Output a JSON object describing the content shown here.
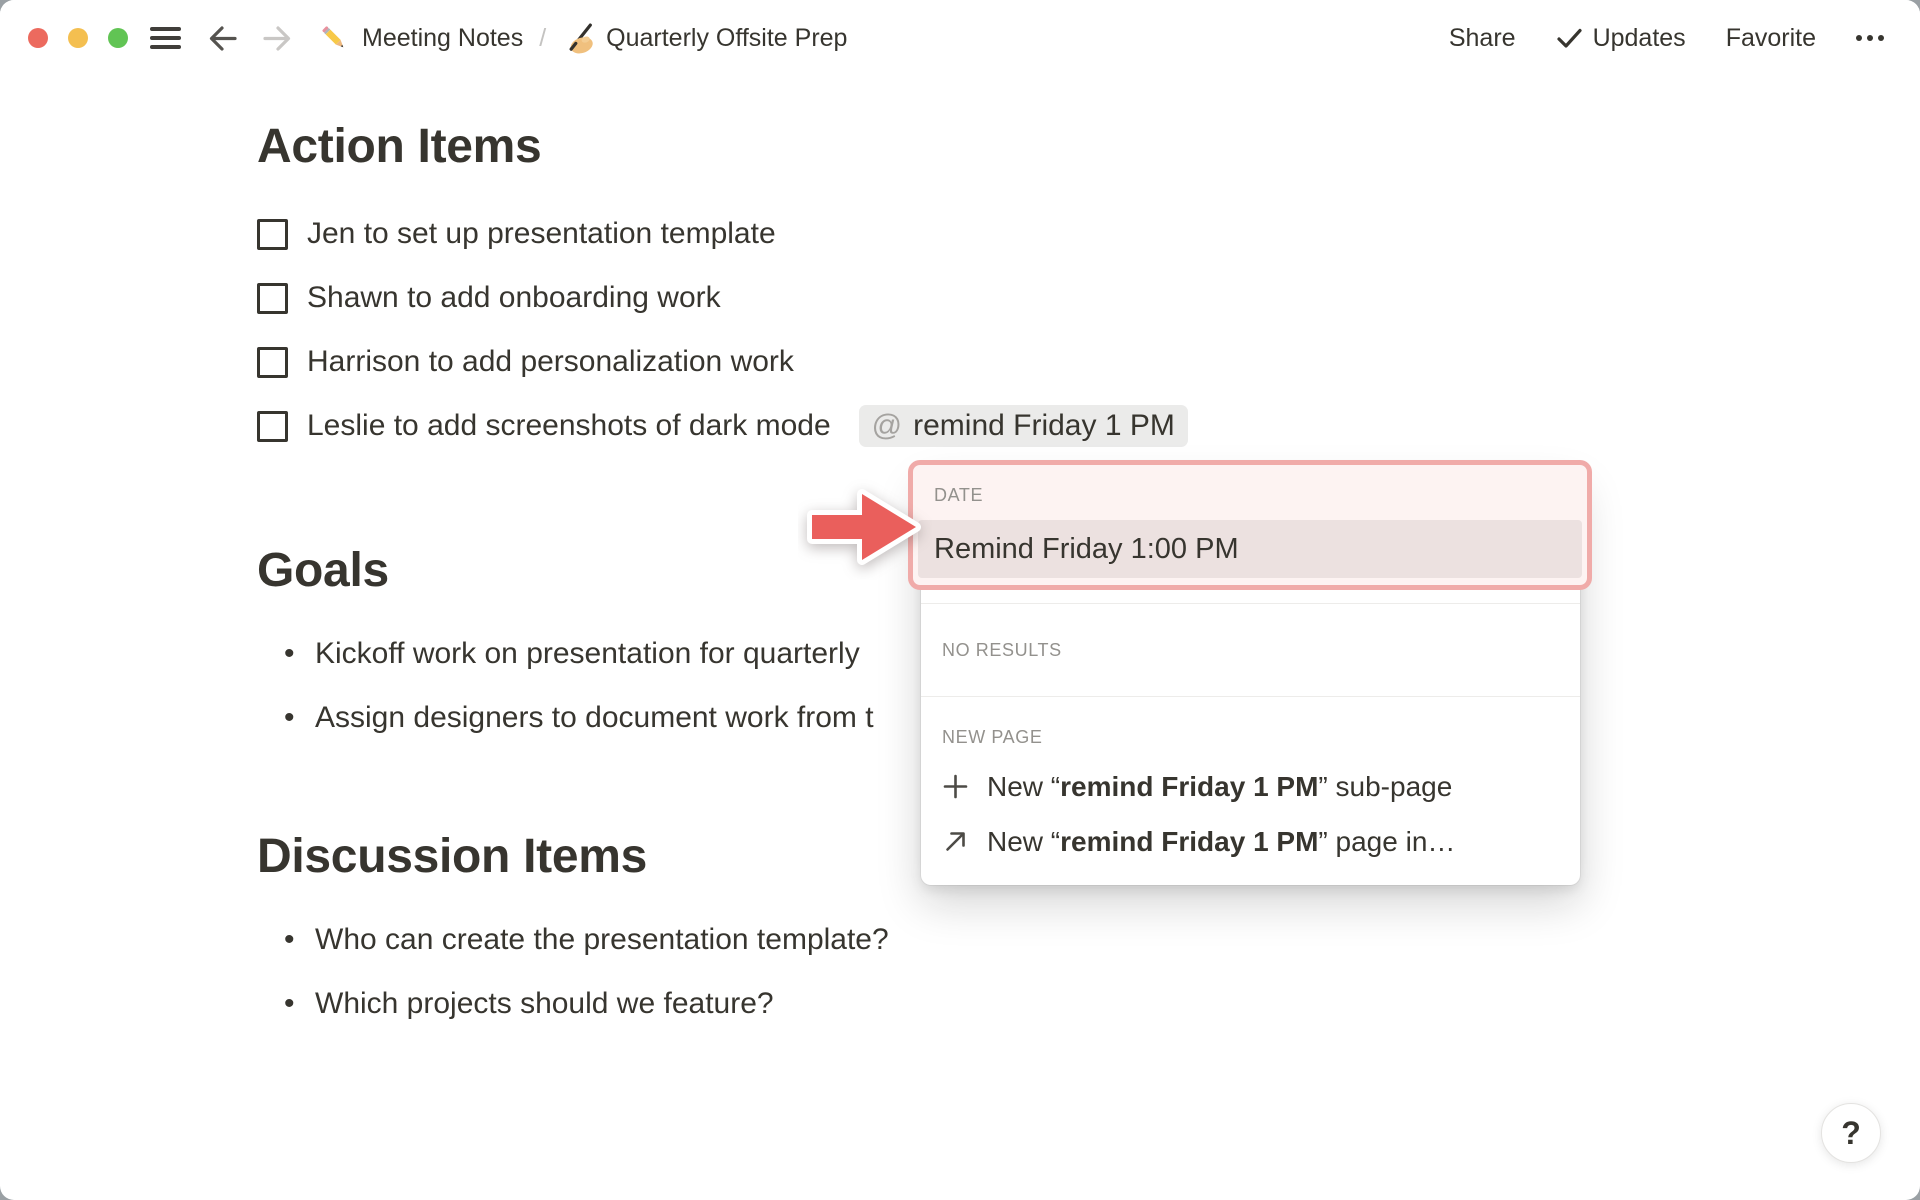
{
  "topbar": {
    "breadcrumb": {
      "page1": "Meeting Notes",
      "separator": "/",
      "page2": "Quarterly Offsite Prep"
    },
    "share": "Share",
    "updates": "Updates",
    "favorite": "Favorite"
  },
  "content": {
    "bullet_char": "•",
    "action_items": {
      "heading": "Action Items",
      "todos": [
        "Jen to set up presentation template",
        "Shawn to add onboarding work",
        "Harrison to add personalization work",
        "Leslie to add screenshots of dark mode"
      ],
      "mention": {
        "at": "@",
        "text": "remind Friday 1 PM"
      }
    },
    "goals": {
      "heading": "Goals",
      "bullets": [
        "Kickoff work on presentation for quarterly",
        "Assign designers to document work from t"
      ]
    },
    "discussion": {
      "heading": "Discussion Items",
      "bullets": [
        "Who can create the presentation template?",
        "Which projects should we feature?"
      ]
    }
  },
  "popup": {
    "date_label": "DATE",
    "date_result": "Remind Friday 1:00 PM",
    "no_results_label": "NO RESULTS",
    "new_page_label": "NEW PAGE",
    "items": [
      {
        "prefix": "New “",
        "bold": "remind Friday 1 PM",
        "suffix": "” sub-page"
      },
      {
        "prefix": "New “",
        "bold": "remind Friday 1 PM",
        "suffix": "” page in…"
      }
    ]
  },
  "help_button": "?",
  "colors": {
    "text": "#37352F",
    "muted_label": "#93918D",
    "mention_bg": "#EBEBEA",
    "highlight_border": "#F0ABA9",
    "highlight_bg": "#FDF3F2",
    "highlight_row_bg": "#ECE1E0",
    "callout_red": "#EA5F5C",
    "traffic_red": "#EC6A5E",
    "traffic_yellow": "#F4BF50",
    "traffic_green": "#61C454"
  }
}
